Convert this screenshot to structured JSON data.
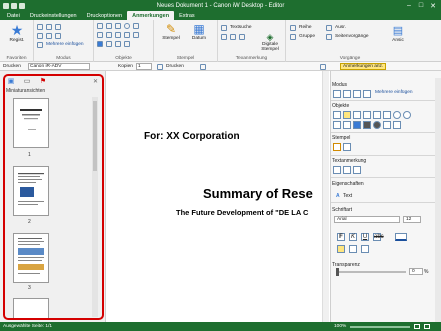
{
  "window": {
    "title": "Neues Dokument 1 - Canon iW Desktop - Editor",
    "minimize": "–",
    "maximize": "□",
    "close": "✕"
  },
  "tabs": [
    "Datei",
    "Druckeinstellungen",
    "Druckoptionen",
    "Anmerkungen",
    "Extras"
  ],
  "active_tab": "Anmerkungen",
  "ribbon": {
    "register_label": "Regist.",
    "mehrere_einfuegen": "Mehrere einfügen",
    "stempel": "Stempel",
    "datum": "Datum",
    "textsuche": "Textsuche",
    "digitale_stempel": "Digitale Stempel",
    "reihe": "Reihe",
    "gruppe": "Gruppe",
    "ausr": "Ausr.",
    "seitenvorgaenge": "Seitenvorgänge",
    "ansic": "Ansic",
    "group_labels": [
      "Favoriten",
      "Modus",
      "Objekte",
      "Stempel",
      "Texanmerkung",
      "Vorgänge"
    ]
  },
  "toolbar2": {
    "drucken_label": "Drucken",
    "printer": "Canon iR-ADV",
    "kopien_label": "Kopien",
    "kopien_value": "1",
    "drucken_btn": "Drucken",
    "annotations_btn": "Anmerkungen anz."
  },
  "left_panel": {
    "tab_icons": [
      "thumbnail-tab",
      "comment-tab",
      "bookmark-tab"
    ],
    "title": "Miniaturansichten",
    "close": "✕",
    "pages": [
      "1",
      "2",
      "3"
    ]
  },
  "document": {
    "for_line": "For: XX Corporation",
    "summary": "Summary of Rese",
    "subtitle": "The Future Development of \"DE LA C"
  },
  "right_panel": {
    "modus": "Modus",
    "mehrere_einfuegen": "Mehrere einfügen",
    "objekte": "Objekte",
    "stempel": "Stempel",
    "textanmerkung": "Textanmerkung",
    "eigenschaften": "Eigenschaften",
    "text_label": "Text",
    "schriftart": "Schriftart",
    "font": "Arial",
    "font_size": "12",
    "transparenz": "Transparenz",
    "transparenz_value": "0",
    "percent": "%"
  },
  "status": {
    "left": "Ausgewählte Seite: 1/1",
    "zoom": "100%"
  },
  "colors": {
    "brand_green": "#1e6e2f",
    "highlight_red": "#d40000"
  }
}
